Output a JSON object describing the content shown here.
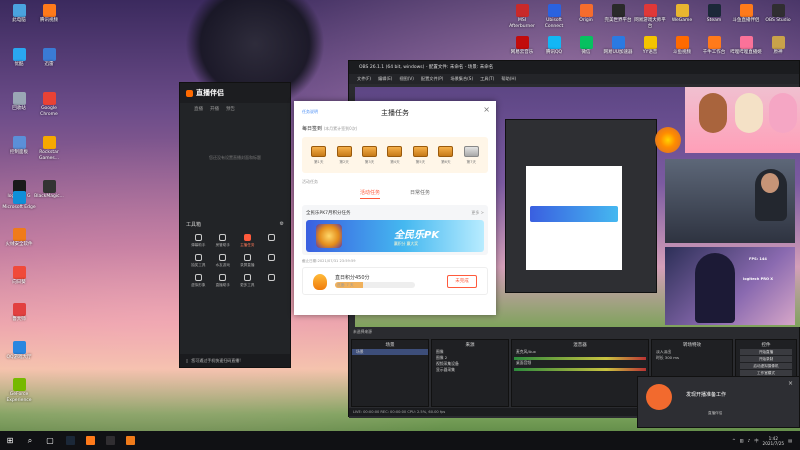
{
  "desktop": {
    "left_icons": [
      {
        "label": "此电脑",
        "color": "#4aa3df"
      },
      {
        "label": "腾讯视频",
        "color": "#ff7a1a"
      },
      {
        "label": "优酷",
        "color": "#2aa7f0"
      },
      {
        "label": "迅雷",
        "color": "#3a7bd5"
      },
      {
        "label": "回收站",
        "color": "#9aa7b5"
      },
      {
        "label": "Google Chrome",
        "color": "#e94235"
      },
      {
        "label": "控制面板",
        "color": "#5b8fd8"
      },
      {
        "label": "Rockstar Games...",
        "color": "#f6a800"
      },
      {
        "label": "logitech G HUB",
        "color": "#1a1a1a"
      },
      {
        "label": "BlackMagic...",
        "color": "#333333"
      },
      {
        "label": "Microsoft Edge",
        "color": "#0f8fd8"
      },
      {
        "label": "火绒安全软件",
        "color": "#f07b1a"
      },
      {
        "label": "向日葵",
        "color": "#f04a3a"
      },
      {
        "label": "鲁大师",
        "color": "#e24040"
      },
      {
        "label": "QQ游戏大厅",
        "color": "#2a86e0"
      },
      {
        "label": "GeForce Experience",
        "color": "#76b900"
      }
    ],
    "top_icons": [
      {
        "label": "MSI Afterburner",
        "color": "#c92a2a"
      },
      {
        "label": "Ubisoft Connect",
        "color": "#2a62e0"
      },
      {
        "label": "Origin",
        "color": "#f56c2d"
      },
      {
        "label": "完美世界平台",
        "color": "#2a2a2a"
      },
      {
        "label": "网易游戏大师平台",
        "color": "#e03838"
      },
      {
        "label": "WeGame",
        "color": "#e9b530"
      },
      {
        "label": "Steam",
        "color": "#1b2838"
      },
      {
        "label": "斗鱼直播伴侣",
        "color": "#ff7a1a"
      },
      {
        "label": "OBS Studio",
        "color": "#302e31"
      },
      {
        "label": "网易云音乐",
        "color": "#c20c0c"
      },
      {
        "label": "腾讯QQ",
        "color": "#12b7f5"
      },
      {
        "label": "微信",
        "color": "#07c160"
      },
      {
        "label": "网易UU加速器",
        "color": "#2a7ae2"
      },
      {
        "label": "YY语音",
        "color": "#f4c400"
      },
      {
        "label": "斗鱼视频",
        "color": "#ff6a00"
      },
      {
        "label": "千牛工作台",
        "color": "#ff7a1a"
      },
      {
        "label": "哔哩哔哩直播姬",
        "color": "#fb7299"
      },
      {
        "label": "原神",
        "color": "#c9a24a"
      }
    ]
  },
  "companion": {
    "title": "直播伴侣",
    "nav": [
      "直播",
      "开播",
      "预告"
    ],
    "empty_text": "您还没有设置直播封面和标题",
    "tools_title": "工具箱",
    "tools": [
      {
        "label": "弹幕助手",
        "active": false
      },
      {
        "label": "房管助手",
        "active": false
      },
      {
        "label": "主播任务",
        "active": true
      },
      {
        "label": "",
        "active": false
      },
      {
        "label": "抽奖工具",
        "active": false
      },
      {
        "label": "水友游戏",
        "active": false
      },
      {
        "label": "录屏直播",
        "active": false
      },
      {
        "label": "",
        "active": false
      },
      {
        "label": "虚拟形象",
        "active": false
      },
      {
        "label": "直播助手",
        "active": false
      },
      {
        "label": "更多工具",
        "active": false
      },
      {
        "label": "",
        "active": false
      }
    ],
    "bottom_text": "您可通过手机快速扫码直播!"
  },
  "dialog": {
    "link": "任务说明",
    "title": "主播任务",
    "close": "×",
    "daily_title": "每日签到",
    "daily_sub": "(本月累计签到0次)",
    "chests": [
      "第1天",
      "第2天",
      "第3天",
      "第4天",
      "第5天",
      "第6天",
      "第7天"
    ],
    "activity_label": "活动任务",
    "tabs": [
      "活动任务",
      "日常任务"
    ],
    "active_tab": 0,
    "event_title": "全民乐PK7月积分任务",
    "event_more": "更多 >",
    "banner_title": "全民乐PK",
    "banner_sub": "赢积分 赢大奖",
    "deadline": "截止日期:2021/07/31 23:59:59",
    "task_name": "直日积分450分",
    "task_progress_label": "进度: 7 天",
    "task_progress_fraction": 0.35,
    "task_btn": "未完成"
  },
  "obs": {
    "title": "OBS 26.1.1 (64 bit, windows) - 配置文件: 未命名 - 场景: 未命名",
    "menu": [
      "文件(F)",
      "编辑(E)",
      "视图(V)",
      "配置文件(P)",
      "场景集合(S)",
      "工具(T)",
      "帮助(H)"
    ],
    "stat_a": "logitech PRO X",
    "stat_b": "FPS: 144",
    "sections": [
      {
        "title": "场景",
        "items": [
          "场景"
        ]
      },
      {
        "title": "来源",
        "items": [
          "图像",
          "图像 2",
          "视频采集设备",
          "显示器采集"
        ]
      },
      {
        "title": "混音器",
        "items": [
          "麦克风/Aux",
          "桌面音频"
        ]
      },
      {
        "title": "转场特效",
        "items": [
          "淡入淡出",
          "时长 300 ms"
        ]
      },
      {
        "title": "控件",
        "items": [
          "开始直播",
          "开始录制",
          "启动虚拟摄像机",
          "工作室模式",
          "设置",
          "退出"
        ]
      }
    ],
    "no_source": "未选择来源",
    "status": "LIVE: 00:00:00  REC: 00:00:00  CPU: 2.5%, 60.00 fps"
  },
  "notification": {
    "text": "发现开播准备工作",
    "sub": "直播伴侣",
    "close": "×"
  },
  "taskbar": {
    "start": "⊞",
    "apps": [
      {
        "name": "search-icon",
        "glyph": "⌕"
      },
      {
        "name": "task-view-icon",
        "glyph": "▢"
      },
      {
        "name": "steam-icon",
        "color": "#1b2838"
      },
      {
        "name": "companion-icon",
        "color": "#ff7a1a"
      },
      {
        "name": "obs-icon",
        "color": "#302e31"
      },
      {
        "name": "orange-app-icon",
        "color": "#f07b1a"
      }
    ],
    "time": "1:42",
    "date": "2021/7/25",
    "lang": "中"
  }
}
